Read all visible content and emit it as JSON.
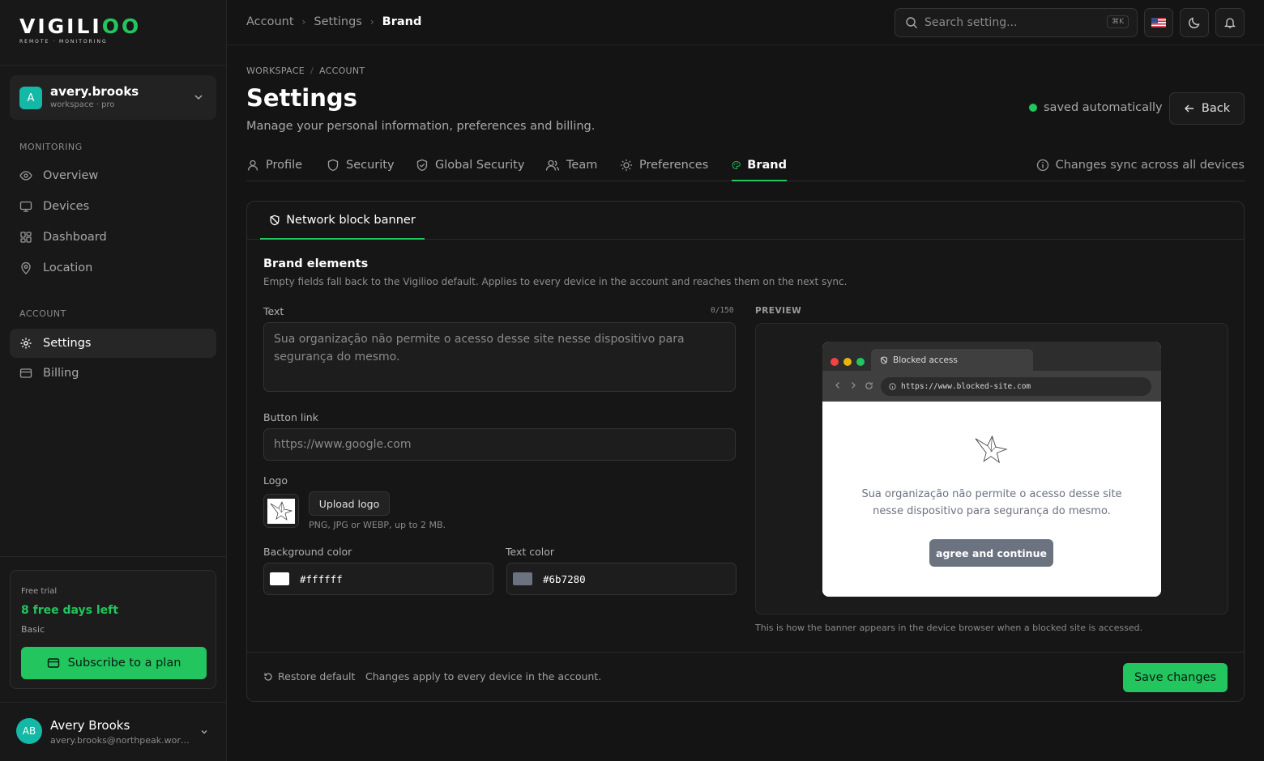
{
  "brand": {
    "logo_main": "VIGILI",
    "logo_accent": "OO",
    "logo_tagline": "REMOTE · MONITORING"
  },
  "workspace": {
    "initial": "A",
    "name": "avery.brooks",
    "sub": "workspace · pro"
  },
  "sidebar": {
    "monitoring_label": "MONITORING",
    "monitoring_items": [
      {
        "label": "Overview",
        "icon": "eye-icon"
      },
      {
        "label": "Devices",
        "icon": "monitor-icon"
      },
      {
        "label": "Dashboard",
        "icon": "dashboard-icon"
      },
      {
        "label": "Location",
        "icon": "map-pin-icon"
      }
    ],
    "account_label": "ACCOUNT",
    "account_items": [
      {
        "label": "Settings",
        "icon": "gear-icon",
        "active": true
      },
      {
        "label": "Billing",
        "icon": "credit-card-icon"
      }
    ]
  },
  "trial": {
    "label": "Free trial",
    "days_left": "8 free days left",
    "plan": "Basic",
    "button": "Subscribe to a plan"
  },
  "user": {
    "initials": "AB",
    "name": "Avery Brooks",
    "email": "avery.brooks@northpeak.workspace"
  },
  "topbar": {
    "breadcrumb": [
      "Account",
      "Settings",
      "Brand"
    ],
    "search_placeholder": "Search setting...",
    "search_shortcut": "⌘K"
  },
  "header": {
    "crumb": [
      "WORKSPACE",
      "ACCOUNT"
    ],
    "title": "Settings",
    "subtitle": "Manage your personal information, preferences and billing.",
    "saved_status": "saved automatically",
    "back_label": "Back"
  },
  "tabs": [
    {
      "label": "Profile",
      "icon": "user-icon"
    },
    {
      "label": "Security",
      "icon": "shield-icon"
    },
    {
      "label": "Global Security",
      "icon": "shield-check-icon"
    },
    {
      "label": "Team",
      "icon": "users-icon"
    },
    {
      "label": "Preferences",
      "icon": "sun-icon"
    },
    {
      "label": "Brand",
      "icon": "palette-icon",
      "active": true
    }
  ],
  "sync_note": "Changes sync across all devices",
  "card": {
    "tab_label": "Network block banner",
    "section_title": "Brand elements",
    "section_desc": "Empty fields fall back to the Vigilioo default. Applies to every device in the account and reaches them on the next sync.",
    "text_label": "Text",
    "text_count": "0/150",
    "text_placeholder": "Sua organização não permite o acesso desse site nesse dispositivo para segurança do mesmo.",
    "button_link_label": "Button link",
    "button_link_placeholder": "https://www.google.com",
    "logo_label": "Logo",
    "upload_label": "Upload logo",
    "upload_hint": "PNG, JPG or WEBP, up to 2 MB.",
    "bg_color_label": "Background color",
    "bg_color": "#ffffff",
    "text_color_label": "Text color",
    "text_color": "#6b7280"
  },
  "preview": {
    "label": "PREVIEW",
    "tab_title": "Blocked access",
    "url": "https://www.blocked-site.com",
    "message": "Sua organização não permite o acesso desse site nesse dispositivo para segurança do mesmo.",
    "button": "agree and continue",
    "caption": "This is how the banner appears in the device browser when a blocked site is accessed."
  },
  "footer": {
    "restore_label": "Restore default",
    "note": "Changes apply to every device in the account.",
    "save_label": "Save changes"
  }
}
